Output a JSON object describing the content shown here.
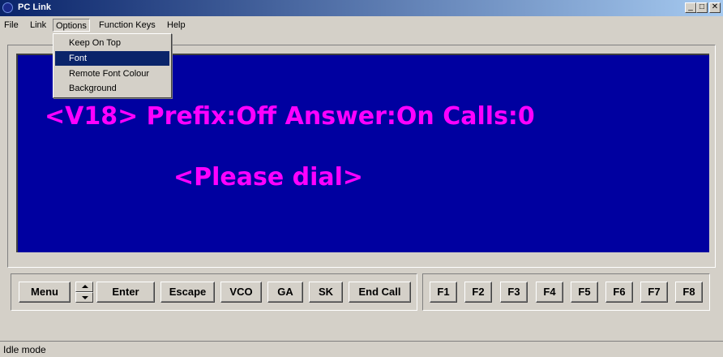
{
  "window": {
    "title": "PC Link",
    "min_label": "_",
    "max_label": "□",
    "close_label": "✕"
  },
  "menu": [
    {
      "label": "File"
    },
    {
      "label": "Link"
    },
    {
      "label": "Options"
    },
    {
      "label": "Function Keys"
    },
    {
      "label": "Help"
    }
  ],
  "options_menu": {
    "items": [
      "Keep On Top",
      "Font",
      "Remote Font Colour",
      "Background"
    ],
    "highlighted": "Font"
  },
  "screen": {
    "line1": "<V18> Prefix:Off    Answer:On  Calls:0",
    "line2": "<Please dial>",
    "background_color": "#0000a0",
    "text_color": "#ff00ff"
  },
  "buttons": {
    "menu": "Menu",
    "enter": "Enter",
    "escape": "Escape",
    "vco": "VCO",
    "ga": "GA",
    "sk": "SK",
    "end_call": "End Call",
    "f1": "F1",
    "f2": "F2",
    "f3": "F3",
    "f4": "F4",
    "f5": "F5",
    "f6": "F6",
    "f7": "F7",
    "f8": "F8"
  },
  "status_bar": {
    "text": "Idle mode"
  },
  "icons": [
    "app-icon",
    "minimize-icon",
    "maximize-icon",
    "close-icon",
    "spin-up-icon",
    "spin-down-icon"
  ]
}
